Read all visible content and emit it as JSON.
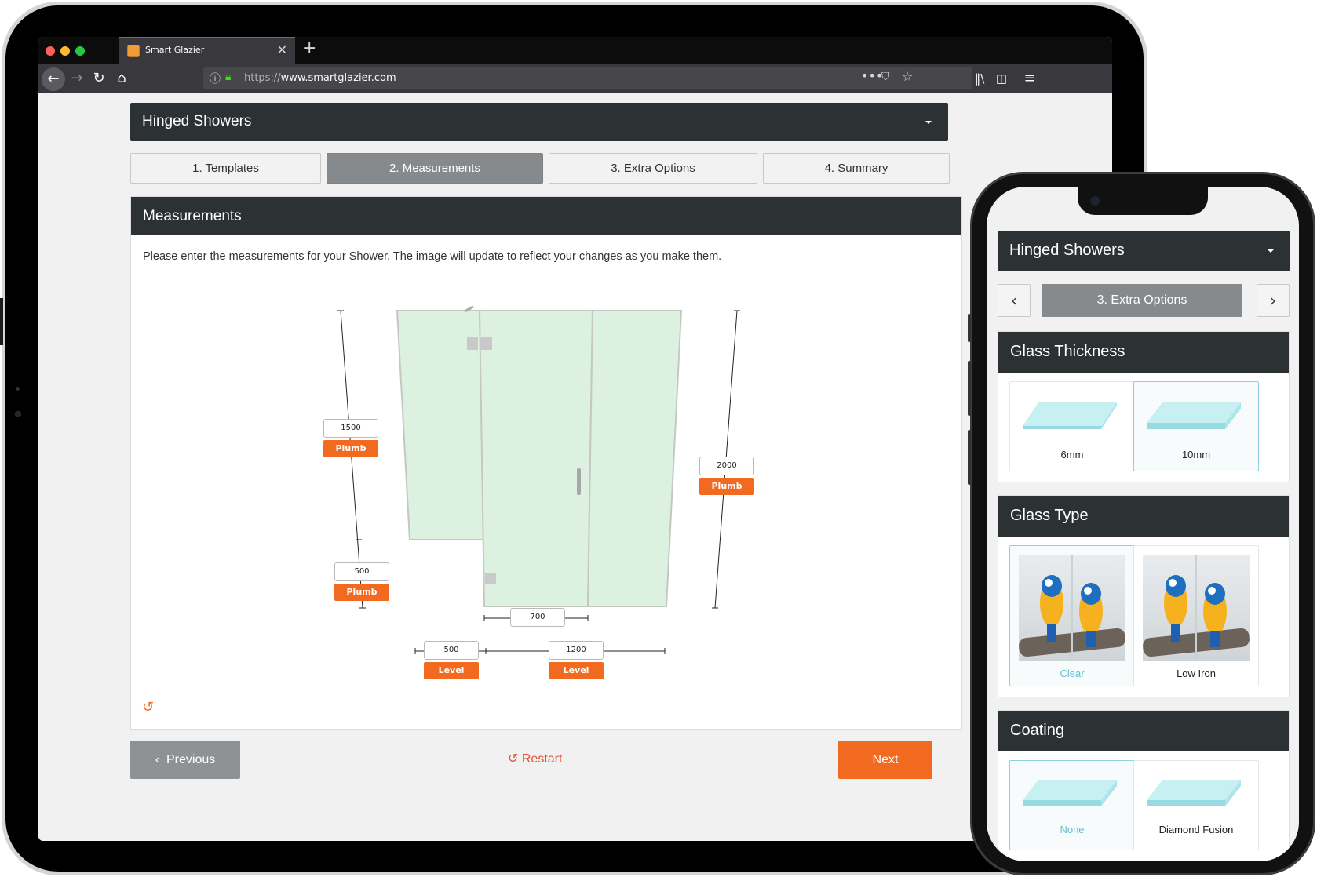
{
  "browser": {
    "tab_title": "Smart Glazier",
    "url_protocol": "https://",
    "url_host": "www.smartglazier.com",
    "icons": [
      "back-icon",
      "forward-icon",
      "reload-icon",
      "home-icon",
      "info-icon",
      "lock-icon",
      "more-icon",
      "pocket-icon",
      "bookmark-star-icon",
      "library-icon",
      "sidebar-icon",
      "menu-icon"
    ]
  },
  "desktop": {
    "product_select": "Hinged Showers",
    "steps": [
      "1. Templates",
      "2. Measurements",
      "3. Extra Options",
      "4. Summary"
    ],
    "active_step": 1,
    "panel_title": "Measurements",
    "instructions": "Please enter the measurements for your Shower. The image will update to reflect your changes as you make them.",
    "measurements": {
      "left_top": {
        "value": "1500",
        "button": "Plumb"
      },
      "left_bottom": {
        "value": "500",
        "button": "Plumb"
      },
      "right": {
        "value": "2000",
        "button": "Plumb"
      },
      "door_width": {
        "value": "700"
      },
      "floor_left": {
        "value": "500",
        "button": "Level"
      },
      "floor_right": {
        "value": "1200",
        "button": "Level"
      }
    },
    "previous_label": "Previous",
    "restart_label": "Restart",
    "next_label": "Next",
    "accent_color": "#f26a1f",
    "header_color": "#2c3134",
    "glass_color": "#dcf1e0"
  },
  "mobile": {
    "product_select": "Hinged Showers",
    "current_step": "3. Extra Options",
    "glass_thickness": {
      "title": "Glass Thickness",
      "options": [
        {
          "label": "6mm",
          "selected": false
        },
        {
          "label": "10mm",
          "selected": true
        }
      ]
    },
    "glass_type": {
      "title": "Glass Type",
      "options": [
        {
          "label": "Clear",
          "selected": true
        },
        {
          "label": "Low Iron",
          "selected": false
        }
      ]
    },
    "coating": {
      "title": "Coating",
      "options": [
        {
          "label": "None",
          "selected": true
        },
        {
          "label": "Diamond Fusion",
          "selected": false
        }
      ]
    },
    "selected_color": "#5fc0cf"
  }
}
